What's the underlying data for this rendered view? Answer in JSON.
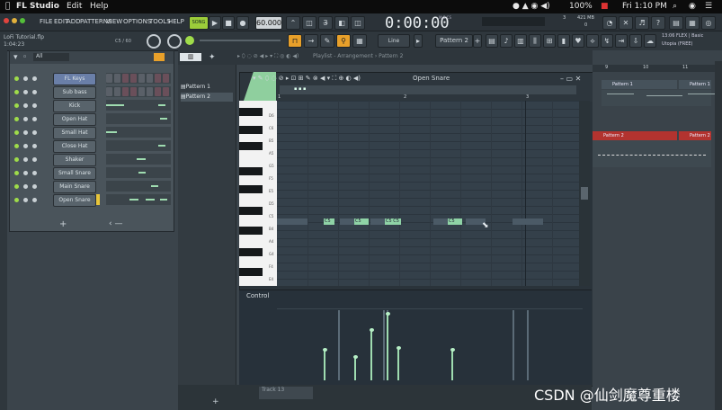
{
  "mac": {
    "app": "FL Studio",
    "menus": [
      "Edit",
      "Help"
    ],
    "battery": "100%",
    "clock": "Fri 1:10 PM"
  },
  "fl_menu": [
    "FILE",
    "EDIT",
    "ADD",
    "PATTERNS",
    "VIEW",
    "OPTIONS",
    "TOOLS",
    "HELP"
  ],
  "transport": {
    "mode": "SONG",
    "tempo": "60.000",
    "time": "0:00:00",
    "time_label": "M:S:CS",
    "cpu": "3",
    "memory": "421 MB",
    "memory_sub": "0"
  },
  "project": {
    "file": "LoFi Tutorial.flp",
    "time": "1:04:23",
    "pos": "C5 / 60"
  },
  "toolbar2": {
    "snap": "Line",
    "pattern": "Pattern 2",
    "news_line1": "13:06 FLEX | Basic",
    "news_line2": "Utopia (FREE)"
  },
  "rack": {
    "filter": "All",
    "channels": [
      "FL Keys",
      "Sub bass",
      "Kick",
      "Open Hat",
      "Small Hat",
      "Close Hat",
      "Shaker",
      "Small Snare",
      "Main Snare",
      "Open Snare"
    ],
    "add": "+"
  },
  "playlist": {
    "title": "Playlist - Arrangement › Pattern 2",
    "patterns": [
      "Pattern 1",
      "Pattern 2"
    ],
    "track": "Track 13",
    "clips": [
      "Pattern 1",
      "Pattern 1",
      "Pattern 2",
      "Pattern 2"
    ],
    "ruler": [
      "9",
      "10",
      "11"
    ]
  },
  "pianoroll": {
    "instrument": "Open Snare",
    "ruler": [
      "1",
      "2",
      "3"
    ],
    "key_labels": [
      "D6",
      "C6",
      "B5",
      "A5",
      "G5",
      "F5",
      "E5",
      "D5",
      "C5",
      "B4",
      "A4",
      "G4",
      "F4",
      "E4"
    ],
    "notes": [
      "C5",
      "C5",
      "C5 C5",
      "C5"
    ],
    "control_label": "Control"
  },
  "watermark": "CSDN @仙剑魔尊重楼"
}
